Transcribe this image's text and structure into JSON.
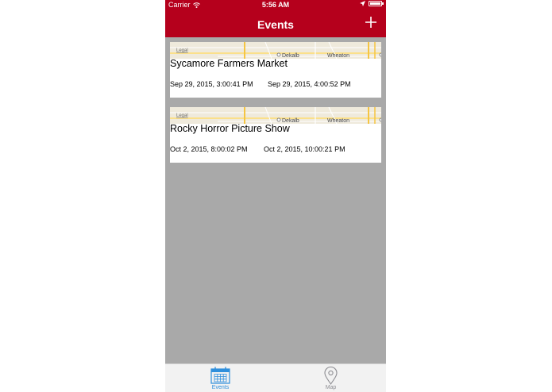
{
  "status_bar": {
    "carrier": "Carrier",
    "time": "5:56 AM"
  },
  "nav": {
    "title": "Events",
    "add_icon": "plus-icon"
  },
  "events": [
    {
      "name": "Sycamore Farmers Market",
      "start": "Sep 29, 2015, 3:00:41 PM",
      "end": "Sep 29, 2015, 4:00:52 PM",
      "map": {
        "legal": "Legal",
        "city1": "Dekalb",
        "city2": "Wheaton"
      }
    },
    {
      "name": "Rocky Horror Picture Show",
      "start": "Oct 2, 2015, 8:00:02 PM",
      "end": "Oct 2, 2015, 10:00:21 PM",
      "map": {
        "legal": "Legal",
        "city1": "Dekalb",
        "city2": "Wheaton"
      }
    }
  ],
  "tabs": [
    {
      "label": "Events",
      "icon": "calendar-icon",
      "selected": true
    },
    {
      "label": "Map",
      "icon": "map-pin-icon",
      "selected": false
    }
  ],
  "colors": {
    "brand": "#b5001c",
    "tint": "#2f8fdc",
    "background": "#a9a9a9"
  }
}
